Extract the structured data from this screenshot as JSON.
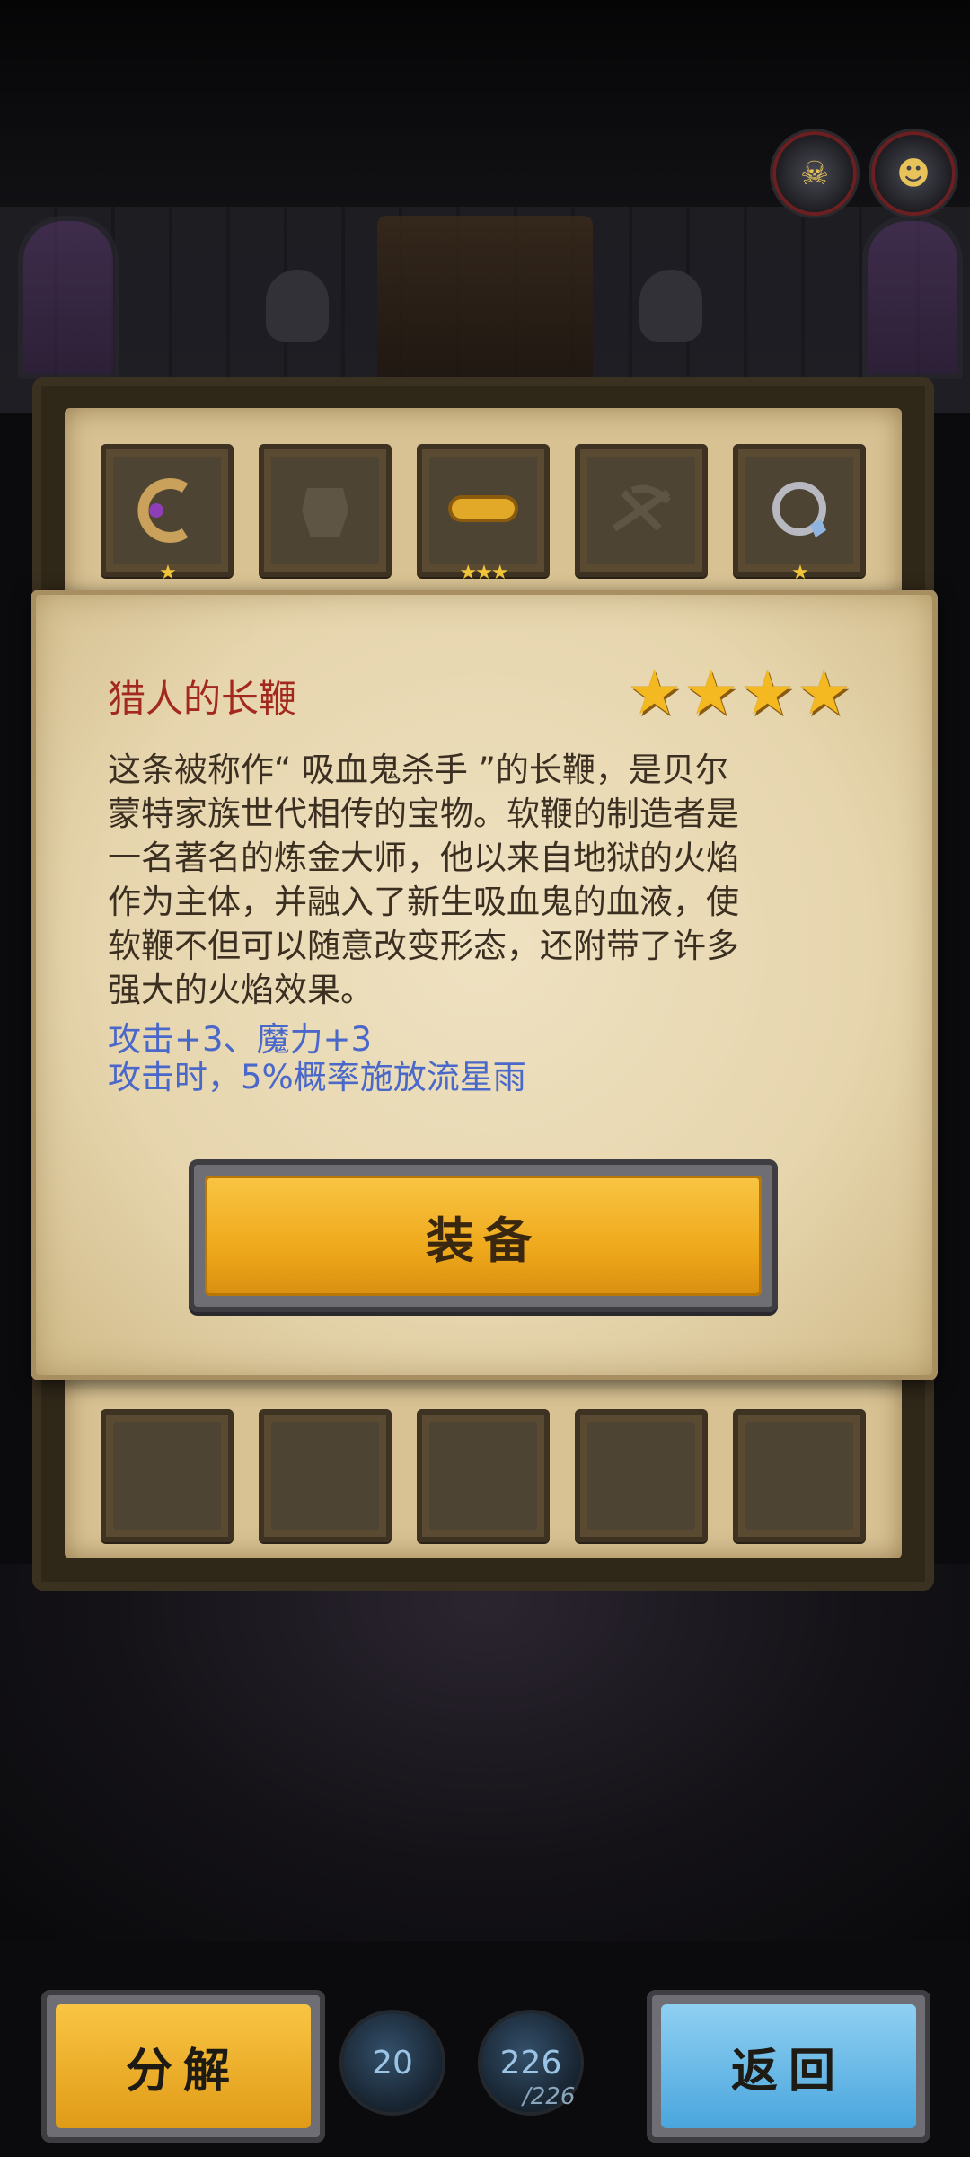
{
  "top_icons": [
    {
      "icon": "teal-monster-portrait-icon"
    },
    {
      "icon": "hero-portrait-icon"
    }
  ],
  "inventory": {
    "top_row": [
      {
        "icon": "whip-icon",
        "stars": "★"
      },
      {
        "icon": "armor-silhouette-icon",
        "stars": ""
      },
      {
        "icon": "bracelet-icon",
        "stars": "★★★"
      },
      {
        "icon": "crossbow-silhouette-icon",
        "stars": ""
      },
      {
        "icon": "ring-icon",
        "stars": "★"
      }
    ]
  },
  "item_dialog": {
    "name": "猎人的长鞭",
    "rating": 4,
    "description_lines": [
      "这条被称作“ 吸血鬼杀手 ”的长鞭，是贝尔",
      "蒙特家族世代相传的宝物。软鞭的制造者是",
      "一名著名的炼金大师，他以来自地狱的火焰",
      "作为主体，并融入了新生吸血鬼的血液，使",
      "软鞭不但可以随意改变形态，还附带了许多",
      "强大的火焰效果。"
    ],
    "effects": [
      "攻击+3、魔力+3",
      "攻击时，5%概率施放流星雨"
    ],
    "equip_label": "装备"
  },
  "bottom_bar": {
    "decompose_label": "分解",
    "return_label": "返回",
    "counter_left": "20",
    "counter_right": "226",
    "counter_right_max": "/226"
  },
  "colors": {
    "item_name": "#a3291f",
    "effect_text": "#4a68c9",
    "gold_button": "#efa91c",
    "blue_button": "#4aa6dd",
    "star": "#f4b820"
  }
}
